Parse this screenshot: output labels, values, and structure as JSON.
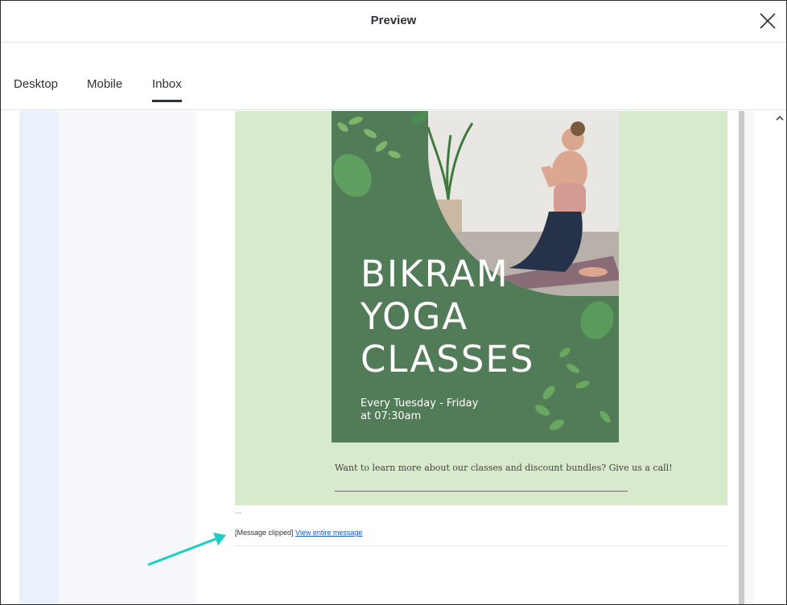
{
  "dialog": {
    "title": "Preview"
  },
  "tabs": [
    {
      "label": "Desktop"
    },
    {
      "label": "Mobile"
    },
    {
      "label": "Inbox"
    }
  ],
  "email": {
    "flyer": {
      "title_lines": [
        "BIKRAM",
        "YOGA",
        "CLASSES"
      ],
      "schedule_lines": [
        "Every Tuesday - Friday",
        "at 07:30am"
      ]
    },
    "cta_text": "Want to learn more about our classes and discount bundles? Give us a call!",
    "ellipsis": "...",
    "clipped_text": "[Message clipped]",
    "view_link": "View entire message"
  },
  "colors": {
    "email_background": "#d7eacb",
    "flyer_green": "#527c58",
    "annotation_arrow": "#1ccfc4",
    "link": "#1a55c4"
  },
  "icons": {
    "close": "close-icon",
    "scroll_up": "chevron-up-icon",
    "annotation": "arrow-icon"
  }
}
